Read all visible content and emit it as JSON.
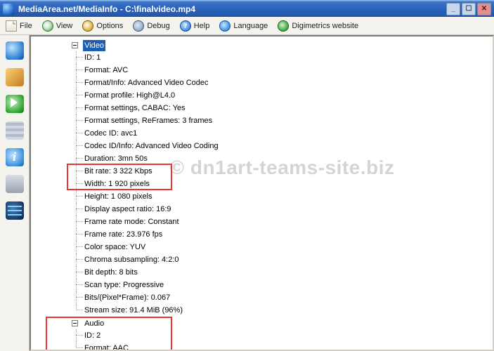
{
  "title": "MediaArea.net/MediaInfo - C:\\finalvideo.mp4",
  "menu": {
    "file": "File",
    "view": "View",
    "options": "Options",
    "debug": "Debug",
    "help": "Help",
    "language": "Language",
    "website": "Digimetrics website"
  },
  "tree": {
    "video_category": "Video",
    "audio_category": "Audio",
    "video": {
      "id": "ID: 1",
      "format": "Format: AVC",
      "format_info": "Format/Info: Advanced Video Codec",
      "format_profile": "Format profile: High@L4.0",
      "format_settings_cabac": "Format settings, CABAC: Yes",
      "format_settings_ref": "Format settings, ReFrames: 3 frames",
      "codec_id": "Codec ID: avc1",
      "codec_id_info": "Codec ID/Info: Advanced Video Coding",
      "duration": "Duration: 3mn 50s",
      "bit_rate": "Bit rate: 3 322 Kbps",
      "width": "Width: 1 920 pixels",
      "height": "Height: 1 080 pixels",
      "dar": "Display aspect ratio: 16:9",
      "frame_rate_mode": "Frame rate mode: Constant",
      "frame_rate": "Frame rate: 23.976 fps",
      "color_space": "Color space: YUV",
      "chroma": "Chroma subsampling: 4:2:0",
      "bit_depth": "Bit depth: 8 bits",
      "scan_type": "Scan type: Progressive",
      "bits_per_pixel": "Bits/(Pixel*Frame): 0.067",
      "stream_size": "Stream size: 91.4 MiB (96%)"
    },
    "audio": {
      "id": "ID: 2",
      "format": "Format: AAC"
    }
  },
  "watermark": "© dn1art-teams-site.biz"
}
